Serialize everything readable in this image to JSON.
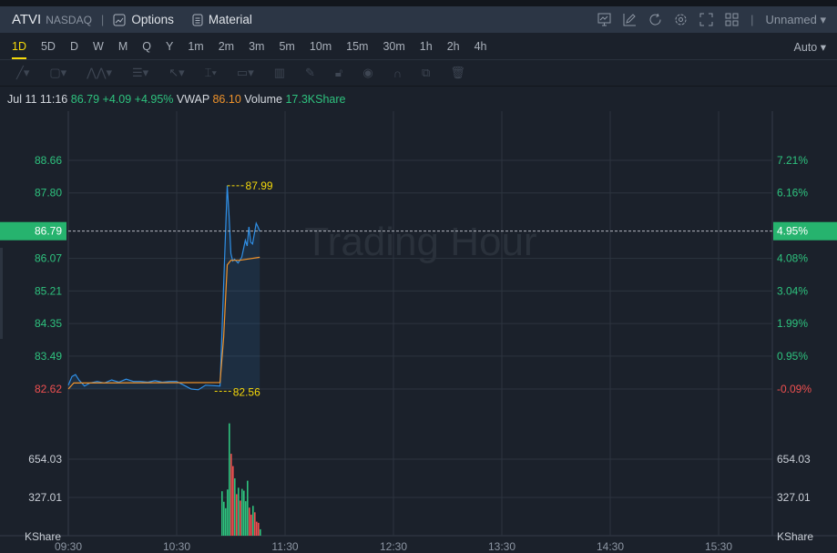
{
  "header": {
    "symbol": "ATVI",
    "exchange": "NASDAQ",
    "options": "Options",
    "material": "Material",
    "layout": "Unnamed"
  },
  "timeframes": [
    "1D",
    "5D",
    "D",
    "W",
    "M",
    "Q",
    "Y",
    "1m",
    "2m",
    "3m",
    "5m",
    "10m",
    "15m",
    "30m",
    "1h",
    "2h",
    "4h"
  ],
  "active_timeframe": "1D",
  "scale_mode": "Auto",
  "info": {
    "time": "Jul 11 11:16",
    "price": "86.79",
    "change": "+4.09",
    "change_pct": "+4.95%",
    "vwap_label": "VWAP",
    "vwap": "86.10",
    "volume_label": "Volume",
    "volume": "17.3KShare"
  },
  "watermark": "Trading Hour",
  "colors": {
    "up": "#2ec27e",
    "down": "#f05050",
    "price_line": "#2f8fe6",
    "vwap_line": "#f0932b",
    "highlight": "#f5d90a"
  },
  "chart_data": {
    "type": "line",
    "price_ticks": [
      "88.66",
      "87.80",
      "86.07",
      "85.21",
      "84.35",
      "83.49",
      "82.62"
    ],
    "pct_ticks": [
      "7.21%",
      "6.16%",
      "4.08%",
      "3.04%",
      "1.99%",
      "0.95%",
      "-0.09%"
    ],
    "current_price": "86.79",
    "current_pct": "4.95%",
    "high_label": "87.99",
    "low_label": "82.56",
    "volume_ticks": [
      "654.03",
      "327.01"
    ],
    "volume_unit": "KShare",
    "x_ticks": [
      "09:30",
      "10:30",
      "11:30",
      "12:30",
      "13:30",
      "14:30",
      "15:30"
    ],
    "ylim": [
      82.62,
      88.66
    ],
    "price": [
      [
        0,
        82.72
      ],
      [
        2,
        82.95
      ],
      [
        4,
        83.0
      ],
      [
        6,
        82.85
      ],
      [
        9,
        82.7
      ],
      [
        12,
        82.78
      ],
      [
        16,
        82.82
      ],
      [
        20,
        82.78
      ],
      [
        24,
        82.86
      ],
      [
        28,
        82.8
      ],
      [
        32,
        82.88
      ],
      [
        36,
        82.82
      ],
      [
        40,
        82.82
      ],
      [
        44,
        82.8
      ],
      [
        48,
        82.84
      ],
      [
        52,
        82.8
      ],
      [
        56,
        82.82
      ],
      [
        60,
        82.82
      ],
      [
        64,
        82.72
      ],
      [
        68,
        82.62
      ],
      [
        72,
        82.6
      ],
      [
        76,
        82.72
      ],
      [
        84,
        82.7
      ],
      [
        86,
        85.4
      ],
      [
        88,
        87.99
      ],
      [
        89,
        87.2
      ],
      [
        90,
        86.2
      ],
      [
        91,
        86.0
      ],
      [
        92,
        86.05
      ],
      [
        94,
        85.95
      ],
      [
        96,
        86.1
      ],
      [
        98,
        86.55
      ],
      [
        99,
        86.4
      ],
      [
        100,
        86.9
      ],
      [
        101,
        86.5
      ],
      [
        102,
        86.45
      ],
      [
        104,
        87.0
      ],
      [
        105,
        86.9
      ],
      [
        106,
        86.79
      ]
    ],
    "vwap": [
      [
        0,
        82.62
      ],
      [
        3,
        82.78
      ],
      [
        84,
        82.79
      ],
      [
        86,
        84.0
      ],
      [
        88,
        85.9
      ],
      [
        90,
        86.02
      ],
      [
        95,
        86.02
      ],
      [
        106,
        86.1
      ]
    ],
    "volume_start_min": 85,
    "volume": [
      380,
      290,
      235,
      395,
      960,
      700,
      595,
      490,
      355,
      410,
      300,
      400,
      385,
      295,
      470,
      240,
      180,
      255,
      200,
      120,
      110,
      55
    ],
    "volume_up": [
      1,
      1,
      1,
      1,
      1,
      0,
      0,
      1,
      0,
      1,
      0,
      1,
      1,
      1,
      1,
      0,
      0,
      1,
      0,
      0,
      0,
      1
    ]
  }
}
